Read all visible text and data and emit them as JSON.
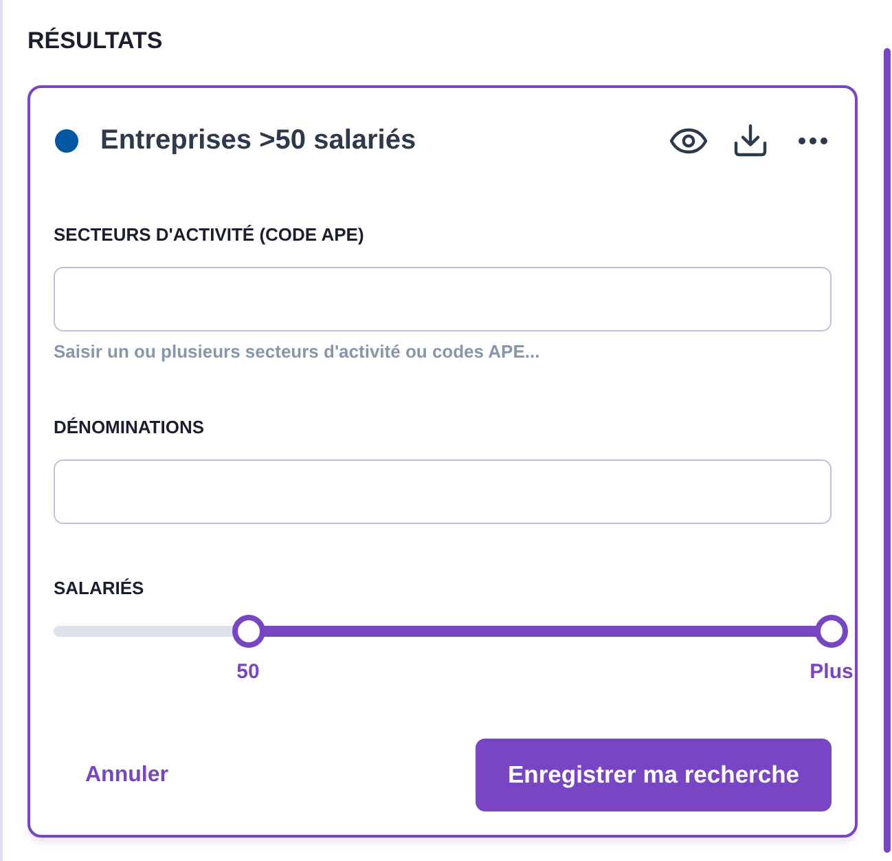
{
  "section_title": "RÉSULTATS",
  "search": {
    "title": "Entreprises >50 salariés",
    "color": "#0057a3",
    "fields": [
      {
        "kind": "text",
        "label": "SECTEURS D'ACTIVITÉ (CODE APE)",
        "help": "Saisir un ou plusieurs secteurs d'activité ou codes APE..."
      },
      {
        "kind": "text",
        "label": "DÉNOMINATIONS"
      },
      {
        "kind": "range",
        "label": "SALARIÉS",
        "thumbs": [
          {
            "level": 0.25,
            "reading": "50"
          },
          {
            "level": 1,
            "reading": "Plus"
          }
        ]
      }
    ],
    "actions": [
      {
        "kind": "link",
        "label": "Annuler"
      },
      {
        "kind": "primary",
        "label": "Enregistrer ma recherche"
      }
    ]
  }
}
